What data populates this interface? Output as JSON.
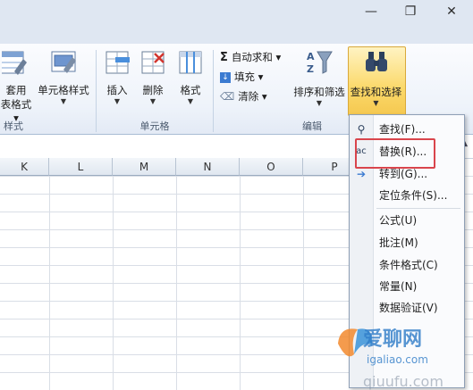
{
  "window": {
    "minimize": "—",
    "restore": "❐",
    "close": "✕"
  },
  "tabbar_icons": [
    "^",
    "?",
    "—",
    "❐",
    "✕"
  ],
  "ribbon": {
    "groups": {
      "styles_label": "样式",
      "cells_label": "单元格",
      "editing_label": "编辑"
    },
    "table_format_label_top": "套用",
    "table_format_label_bottom": "表格式 ▾",
    "cell_styles_label": "单元格样式",
    "insert_label": "插入",
    "delete_label": "删除",
    "format_label": "格式",
    "autosum_label": "自动求和 ▾",
    "fill_label": "填充 ▾",
    "clear_label": "清除 ▾",
    "sort_filter_label": "排序和筛选",
    "find_select_label": "查找和选择"
  },
  "columns": [
    "K",
    "L",
    "M",
    "N",
    "O",
    "P"
  ],
  "menu": {
    "items": [
      {
        "label": "查找(F)..."
      },
      {
        "label": "替换(R)..."
      },
      {
        "label": "转到(G)..."
      },
      {
        "label": "定位条件(S)..."
      },
      {
        "label": "公式(U)"
      },
      {
        "label": "批注(M)"
      },
      {
        "label": "条件格式(C)"
      },
      {
        "label": "常量(N)"
      },
      {
        "label": "数据验证(V)"
      }
    ]
  },
  "watermark": {
    "brand": "爱聊网",
    "url": "igaliao.com",
    "bottom": "qiuufu.com"
  },
  "colors": {
    "highlight": "#d9454c",
    "accent": "#f3d56a"
  }
}
